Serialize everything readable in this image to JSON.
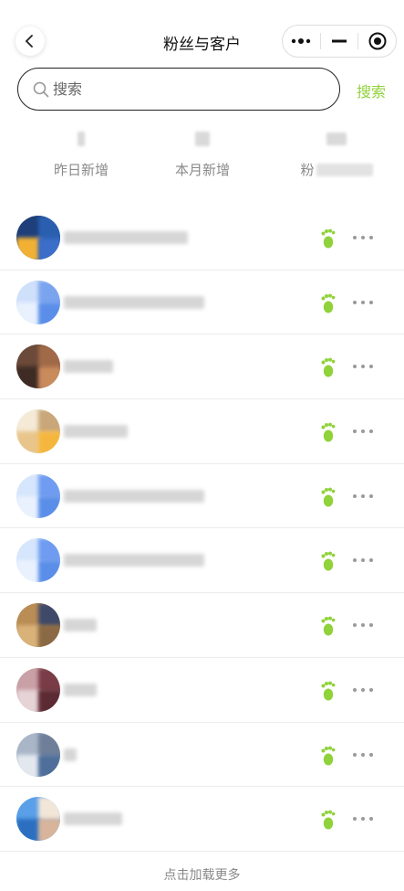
{
  "header": {
    "title": "粉丝与客户"
  },
  "search": {
    "placeholder": "搜索",
    "button_label": "搜索"
  },
  "stats": [
    {
      "label": "昨日新增"
    },
    {
      "label": "本月新增"
    },
    {
      "label": "粉"
    }
  ],
  "customers": [
    {
      "avatar_colors": [
        "#1e3f7a",
        "#2a5fb0",
        "#f2b134",
        "#3b6ec9"
      ],
      "foot_color": "#8fd23a"
    },
    {
      "avatar_colors": [
        "#cfe0fb",
        "#7ba4ef",
        "#e9f1fe",
        "#5b8ee8"
      ],
      "foot_color": "#8fd23a"
    },
    {
      "avatar_colors": [
        "#6b4a3a",
        "#a06a48",
        "#3e2c24",
        "#c98a5c"
      ],
      "foot_color": "#8fd23a"
    },
    {
      "avatar_colors": [
        "#f4ead6",
        "#c9a77a",
        "#e8c58a",
        "#f5b63d"
      ],
      "foot_color": "#8fd23a"
    },
    {
      "avatar_colors": [
        "#d6e6fd",
        "#6f9cf0",
        "#e9f1fe",
        "#5b8ee8"
      ],
      "foot_color": "#8fd23a"
    },
    {
      "avatar_colors": [
        "#d6e6fd",
        "#6f9cf0",
        "#e9f1fe",
        "#5b8ee8"
      ],
      "foot_color": "#8fd23a"
    },
    {
      "avatar_colors": [
        "#b98d55",
        "#3f4a6a",
        "#d9b27a",
        "#8a6a44"
      ],
      "foot_color": "#8fd23a"
    },
    {
      "avatar_colors": [
        "#c9a0a6",
        "#7a3c46",
        "#e6d3d5",
        "#5c2a33"
      ],
      "foot_color": "#8fd23a"
    },
    {
      "avatar_colors": [
        "#a9b6c8",
        "#6f7f99",
        "#e3e8ef",
        "#4f6f9a"
      ],
      "foot_color": "#8fd23a"
    },
    {
      "avatar_colors": [
        "#5aa0e8",
        "#f2e6d8",
        "#2c6fc0",
        "#d8b49a"
      ],
      "foot_color": "#8fd23a"
    }
  ],
  "footer": {
    "load_more_label": "点击加载更多"
  },
  "colors": {
    "accent": "#8fd23a",
    "text_muted": "#8a8a8a"
  }
}
